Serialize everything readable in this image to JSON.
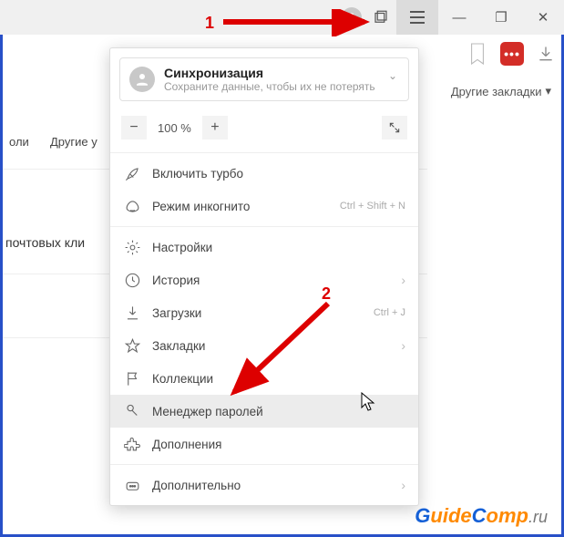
{
  "titlebar": {
    "hamburger_name": "menu-icon",
    "minimize": "—",
    "maximize": "❐",
    "close": "✕"
  },
  "toolbar": {
    "lastpass_dots": "•••",
    "other_bookmarks": "Другие закладки",
    "dropdown_arrow": "▾"
  },
  "background": {
    "text1": "оли",
    "text2": "Другие у",
    "text3": "почтовых кли"
  },
  "sync": {
    "title": "Синхронизация",
    "subtitle": "Сохраните данные, чтобы их не потерять"
  },
  "zoom": {
    "minus": "−",
    "value": "100 %",
    "plus": "+"
  },
  "menu": {
    "turbo": "Включить турбо",
    "incognito": "Режим инкогнито",
    "incognito_shortcut": "Ctrl + Shift + N",
    "settings": "Настройки",
    "history": "История",
    "downloads": "Загрузки",
    "downloads_shortcut": "Ctrl + J",
    "bookmarks": "Закладки",
    "collections": "Коллекции",
    "passwords": "Менеджер паролей",
    "addons": "Дополнения",
    "more": "Дополнительно"
  },
  "arrows": {
    "right": "›"
  },
  "annotations": {
    "one": "1",
    "two": "2"
  },
  "watermark": {
    "g": "G",
    "uide": "uide",
    "c": "C",
    "omp": "omp",
    "ru": ".ru"
  }
}
